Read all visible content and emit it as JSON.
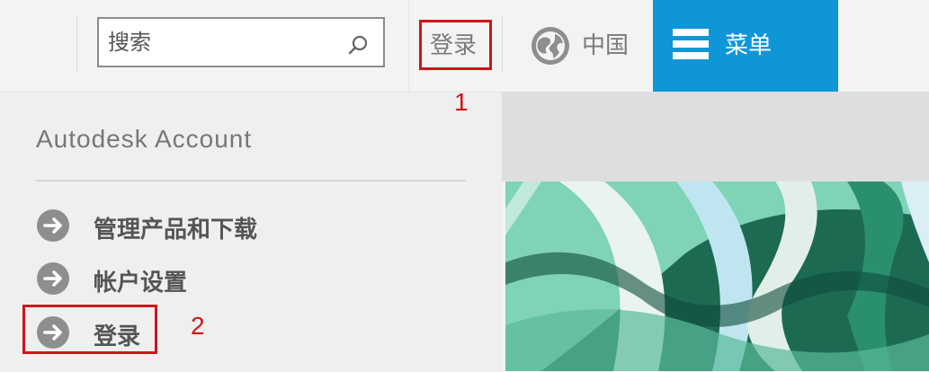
{
  "header": {
    "search": {
      "placeholder": "搜索"
    },
    "login_label": "登录",
    "region_label": "中国",
    "menu_label": "菜单"
  },
  "dropdown": {
    "title": "Autodesk Account",
    "items": [
      {
        "label": "管理产品和下载"
      },
      {
        "label": "帐户设置"
      },
      {
        "label": "登录"
      }
    ]
  },
  "annotations": {
    "marker_1": "1",
    "marker_2": "2"
  },
  "colors": {
    "accent": "#0f96d7",
    "annotation": "#d0141a",
    "header_bg": "#f3f3f3",
    "dropdown_bg": "#efefef",
    "icon_gray": "#8e8e8e"
  }
}
